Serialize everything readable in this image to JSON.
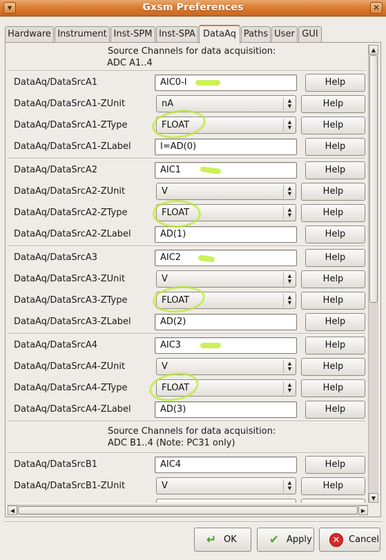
{
  "window": {
    "title": "Gxsm Preferences",
    "menu_glyph": "▾",
    "close_glyph": "✕"
  },
  "tabs": [
    {
      "label": "Hardware"
    },
    {
      "label": "Instrument"
    },
    {
      "label": "Inst-SPM"
    },
    {
      "label": "Inst-SPA"
    },
    {
      "label": "DataAq"
    },
    {
      "label": "Paths"
    },
    {
      "label": "User"
    },
    {
      "label": "GUI"
    }
  ],
  "active_tab": "DataAq",
  "sections": {
    "adc_a": {
      "line1": "Source Channels for data acquisition:",
      "line2": "ADC A1..4"
    },
    "adc_b": {
      "line1": "Source Channels for data acquisition:",
      "line2": "ADC B1..4 (Note: PC31 only)"
    }
  },
  "rows": [
    {
      "label": "DataAq/DataSrcA1",
      "value": "AIC0-I",
      "help": "Help"
    },
    {
      "label": "DataAq/DataSrcA1-ZUnit",
      "value": "nA",
      "help": "Help"
    },
    {
      "label": "DataAq/DataSrcA1-ZType",
      "value": "FLOAT",
      "help": "Help"
    },
    {
      "label": "DataAq/DataSrcA1-ZLabel",
      "value": "I=AD(0)",
      "help": "Help"
    },
    {
      "label": "DataAq/DataSrcA2",
      "value": "AIC1",
      "help": "Help"
    },
    {
      "label": "DataAq/DataSrcA2-ZUnit",
      "value": "V",
      "help": "Help"
    },
    {
      "label": "DataAq/DataSrcA2-ZType",
      "value": "FLOAT",
      "help": "Help"
    },
    {
      "label": "DataAq/DataSrcA2-ZLabel",
      "value": "AD(1)",
      "help": "Help"
    },
    {
      "label": "DataAq/DataSrcA3",
      "value": "AIC2",
      "help": "Help"
    },
    {
      "label": "DataAq/DataSrcA3-ZUnit",
      "value": "V",
      "help": "Help"
    },
    {
      "label": "DataAq/DataSrcA3-ZType",
      "value": "FLOAT",
      "help": "Help"
    },
    {
      "label": "DataAq/DataSrcA3-ZLabel",
      "value": "AD(2)",
      "help": "Help"
    },
    {
      "label": "DataAq/DataSrcA4",
      "value": "AIC3",
      "help": "Help"
    },
    {
      "label": "DataAq/DataSrcA4-ZUnit",
      "value": "V",
      "help": "Help"
    },
    {
      "label": "DataAq/DataSrcA4-ZType",
      "value": "FLOAT",
      "help": "Help"
    },
    {
      "label": "DataAq/DataSrcA4-ZLabel",
      "value": "AD(3)",
      "help": "Help"
    },
    {
      "label": "DataAq/DataSrcB1",
      "value": "AIC4",
      "help": "Help"
    },
    {
      "label": "DataAq/DataSrcB1-ZUnit",
      "value": "V",
      "help": "Help"
    }
  ],
  "scroll": {
    "up_glyph": "▲",
    "down_glyph": "▼",
    "left_glyph": "◀",
    "right_glyph": "▶"
  },
  "dialog_buttons": {
    "ok": {
      "label": "OK",
      "icon": "↵"
    },
    "apply": {
      "label": "Apply",
      "icon": "✔"
    },
    "cancel": {
      "label": "Cancel",
      "icon": "✕"
    }
  },
  "colors": {
    "titlebar": "#d8772b",
    "active_tab_accent": "#d8772b",
    "highlight_marks": "#bee82d"
  }
}
